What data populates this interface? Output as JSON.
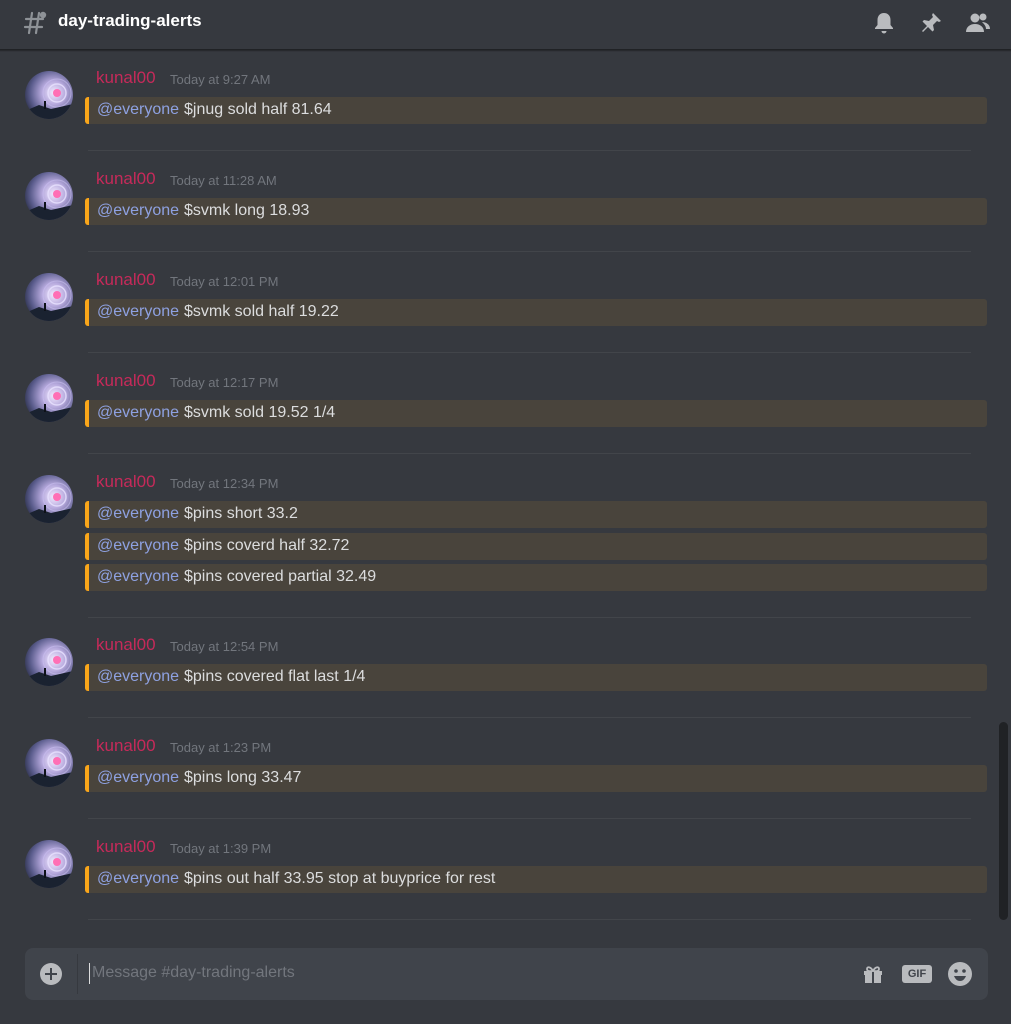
{
  "header": {
    "channel": "day-trading-alerts"
  },
  "messages": [
    {
      "username": "kunal00",
      "timestamp": "Today at 9:27 AM",
      "lines": [
        {
          "mention": "@everyone",
          "text": "$jnug sold half 81.64"
        }
      ]
    },
    {
      "username": "kunal00",
      "timestamp": "Today at 11:28 AM",
      "lines": [
        {
          "mention": "@everyone",
          "text": "$svmk long 18.93"
        }
      ]
    },
    {
      "username": "kunal00",
      "timestamp": "Today at 12:01 PM",
      "lines": [
        {
          "mention": "@everyone",
          "text": "$svmk sold half 19.22"
        }
      ]
    },
    {
      "username": "kunal00",
      "timestamp": "Today at 12:17 PM",
      "lines": [
        {
          "mention": "@everyone",
          "text": "$svmk sold 19.52 1/4"
        }
      ]
    },
    {
      "username": "kunal00",
      "timestamp": "Today at 12:34 PM",
      "lines": [
        {
          "mention": "@everyone",
          "text": "$pins short 33.2"
        },
        {
          "mention": "@everyone",
          "text": "$pins coverd half 32.72"
        },
        {
          "mention": "@everyone",
          "text": "$pins covered partial 32.49"
        }
      ]
    },
    {
      "username": "kunal00",
      "timestamp": "Today at 12:54 PM",
      "lines": [
        {
          "mention": "@everyone",
          "text": "$pins covered flat last 1/4"
        }
      ]
    },
    {
      "username": "kunal00",
      "timestamp": "Today at 1:23 PM",
      "lines": [
        {
          "mention": "@everyone",
          "text": "$pins long 33.47"
        }
      ]
    },
    {
      "username": "kunal00",
      "timestamp": "Today at 1:39 PM",
      "lines": [
        {
          "mention": "@everyone",
          "text": "$pins out half 33.95 stop at buyprice for rest"
        }
      ]
    }
  ],
  "composer": {
    "placeholder": "Message #day-trading-alerts",
    "gif_label": "GIF"
  },
  "colors": {
    "background": "#36393f",
    "username": "#c62a5a",
    "mention": "#8ea1e1",
    "mention_highlight": "#49443c",
    "mention_bar": "#faa61a"
  },
  "icons": [
    "hashtag-icon",
    "bell-icon",
    "pin-icon",
    "members-icon",
    "plus-circle-icon",
    "gift-icon",
    "gif-icon",
    "emoji-icon"
  ]
}
